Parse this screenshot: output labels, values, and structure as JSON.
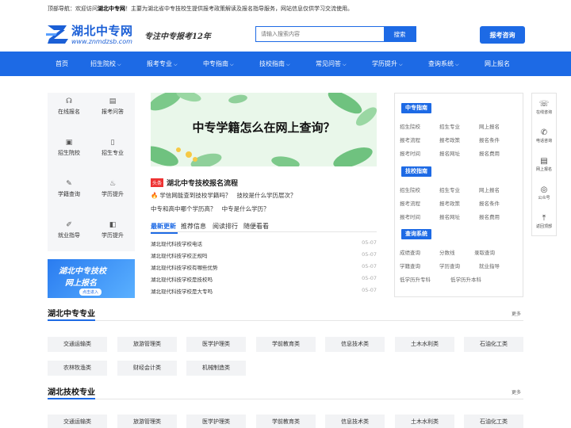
{
  "topbar": {
    "prefix": "顶部导航：欢迎访问",
    "site": "湖北中专网",
    "suffix": "！主要为湖北省中专技校生提供报考政策解读及报名指导服务，网站信息仅供学习交流使用。"
  },
  "logo": {
    "title": "湖北中专网",
    "url": "www.znmdzsb.com"
  },
  "slogan": "专注中专报考12年",
  "search": {
    "placeholder": "请输入搜索内容",
    "button": "搜索"
  },
  "consult_button": "报考咨询",
  "nav": [
    {
      "label": "首页",
      "dropdown": false
    },
    {
      "label": "招生院校",
      "dropdown": true
    },
    {
      "label": "报考专业",
      "dropdown": true
    },
    {
      "label": "中专指南",
      "dropdown": true
    },
    {
      "label": "技校指南",
      "dropdown": true
    },
    {
      "label": "常见问答",
      "dropdown": true
    },
    {
      "label": "学历提升",
      "dropdown": true
    },
    {
      "label": "查询系统",
      "dropdown": true
    },
    {
      "label": "网上报名",
      "dropdown": false
    }
  ],
  "nav_chevron": "⌵",
  "quick_links": [
    {
      "label": "在线报名",
      "icon": "headset-icon",
      "glyph": "☊"
    },
    {
      "label": "报考问答",
      "icon": "book-icon",
      "glyph": "▤"
    },
    {
      "label": "招生院校",
      "icon": "school-icon",
      "glyph": "▣"
    },
    {
      "label": "招生专业",
      "icon": "document-icon",
      "glyph": "▯"
    },
    {
      "label": "学籍查询",
      "icon": "pen-icon",
      "glyph": "✎"
    },
    {
      "label": "学历提升",
      "icon": "fire-icon",
      "glyph": "♨"
    },
    {
      "label": "就业指导",
      "icon": "edit-icon",
      "glyph": "✐"
    },
    {
      "label": "学历提升",
      "icon": "chart-icon",
      "glyph": "◧"
    }
  ],
  "left_banner": {
    "line1": "湖北中专技校",
    "line2": "网上报名",
    "cta": "点击进入"
  },
  "hero": {
    "title": "中专学籍怎么在网上查询？"
  },
  "headline": {
    "badge": "头条",
    "title": "湖北中专技校报名流程"
  },
  "hot": {
    "fire": "🔥",
    "q1": "学信网能查到技校学籍吗？",
    "q2": "技校是什么学历层次？"
  },
  "line2": {
    "q1": "中专和高中哪个学历高？",
    "q2": "中专是什么学历？"
  },
  "tabs": [
    "最新更新",
    "推荐信息",
    "阅读排行",
    "随便看看"
  ],
  "articles": [
    {
      "title": "湖北现代科技学校电话",
      "date": "05-07"
    },
    {
      "title": "湖北现代科技学校正规吗",
      "date": "05-07"
    },
    {
      "title": "湖北现代科技学校有哪些优势",
      "date": "05-07"
    },
    {
      "title": "湖北现代科技学校是技校吗",
      "date": "05-07"
    },
    {
      "title": "湖北现代科技学校是大专吗",
      "date": "05-07"
    }
  ],
  "right_panel": {
    "zhongzhuan": {
      "title": "中专指南",
      "links": [
        "招生院校",
        "招生专业",
        "网上报名",
        "报考流程",
        "报考政策",
        "报名条件",
        "报考时间",
        "报名网址",
        "报名费用"
      ]
    },
    "jixiao": {
      "title": "技校指南",
      "links": [
        "招生院校",
        "招生专业",
        "网上报名",
        "报考流程",
        "报考政策",
        "报名条件",
        "报考时间",
        "报名网址",
        "报名费用"
      ]
    },
    "query": {
      "title": "查询系统",
      "links": [
        "成绩查询",
        "分数线",
        "录取查询",
        "学籍查询",
        "学历查询",
        "就业指导",
        "低学历升专科",
        "低学历升本科"
      ]
    }
  },
  "sidebar": [
    {
      "label": "在线咨询",
      "icon": "headset-icon",
      "glyph": "☏"
    },
    {
      "label": "电话咨询",
      "icon": "phone-icon",
      "glyph": "✆"
    },
    {
      "label": "网上报名",
      "icon": "form-icon",
      "glyph": "▤"
    },
    {
      "label": "公众号",
      "icon": "wechat-icon",
      "glyph": "◎"
    },
    {
      "label": "返回顶部",
      "icon": "arrow-up-icon",
      "glyph": "⤒"
    }
  ],
  "sections": [
    {
      "title": "湖北中专专业",
      "more": "更多",
      "chips": [
        "交通运输类",
        "旅游管理类",
        "医学护理类",
        "学前教育类",
        "信息技术类",
        "土木水利类",
        "石油化工类",
        "农林牧渔类",
        "财经会计类",
        "机械制造类"
      ]
    },
    {
      "title": "湖北技校专业",
      "more": "更多",
      "chips": [
        "交通运输类",
        "旅游管理类",
        "医学护理类",
        "学前教育类",
        "信息技术类",
        "土木水利类",
        "石油化工类"
      ]
    }
  ],
  "colors": {
    "primary": "#1d6ae5",
    "hot": "#e33333"
  }
}
